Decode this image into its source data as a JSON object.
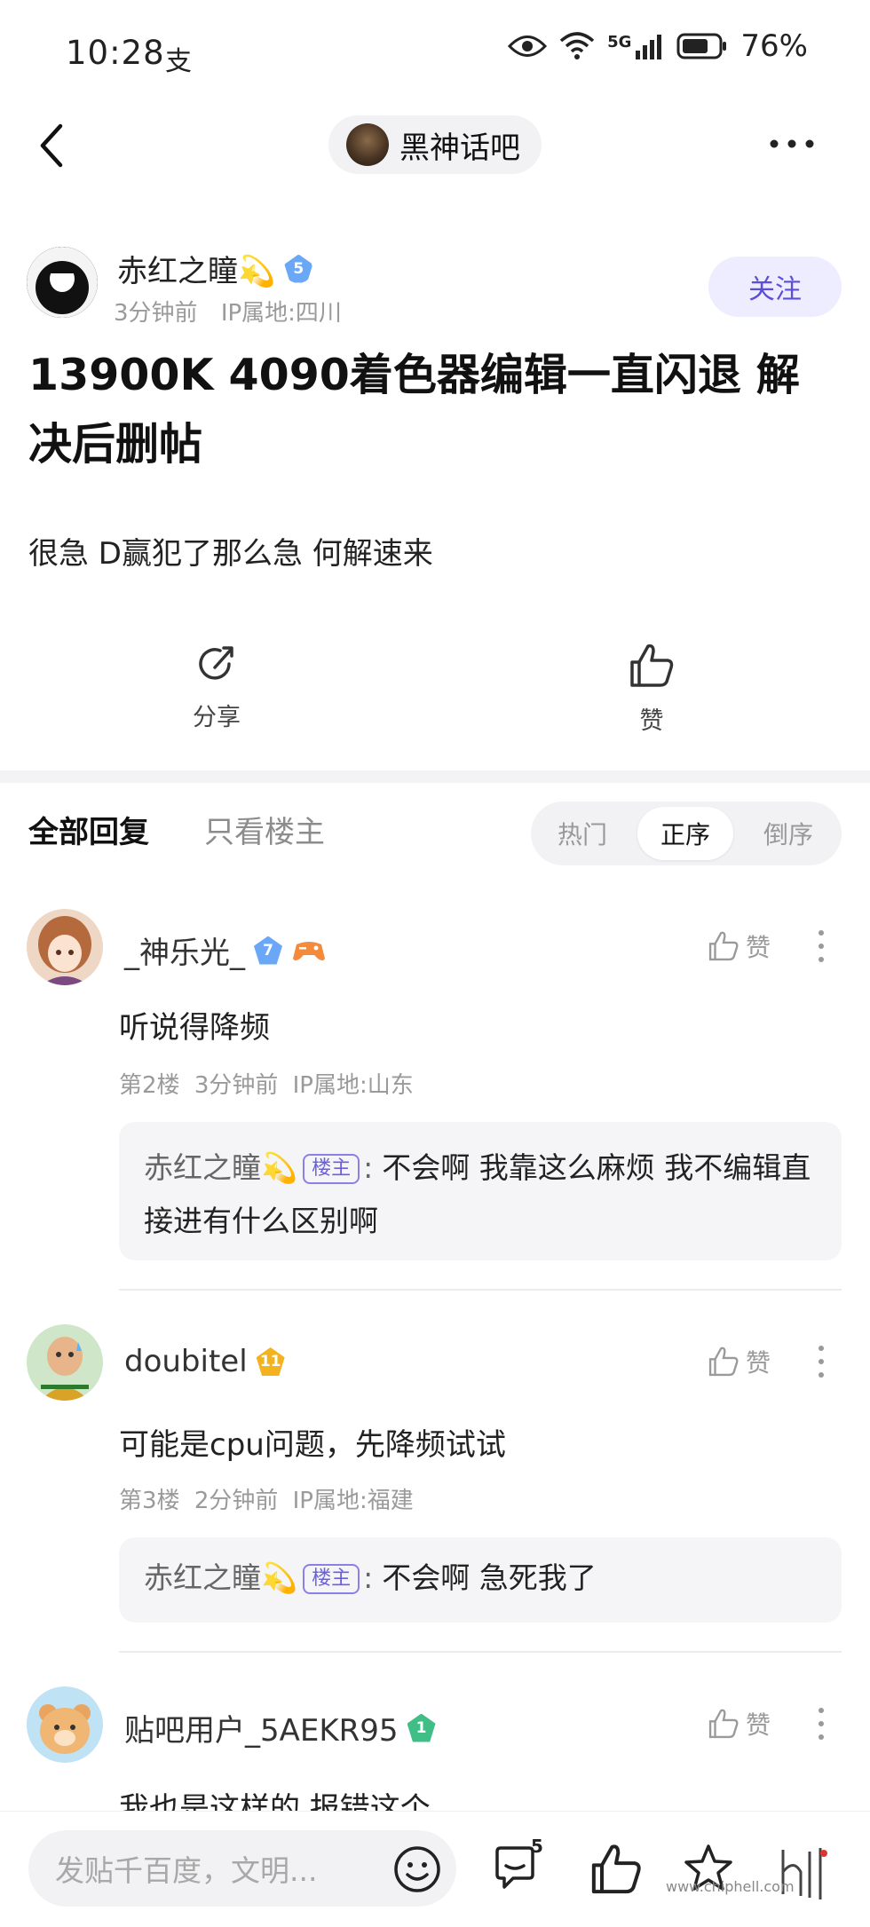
{
  "status_bar": {
    "time": "10:28",
    "alipay_glyph": "支",
    "network": "5G",
    "battery": "76%"
  },
  "header": {
    "forum_name": "黑神话吧"
  },
  "post": {
    "author": "赤红之瞳💫",
    "author_level": "5",
    "time": "3分钟前",
    "ip": "IP属地:四川",
    "follow_label": "关注",
    "title": "13900K  4090着色器编辑一直闪退 解决后删帖",
    "body": "很急 D赢犯了那么急 何解速来",
    "share_label": "分享",
    "like_label": "赞"
  },
  "tabs": {
    "all_label": "全部回复",
    "host_only_label": "只看楼主"
  },
  "sort": {
    "options": [
      "热门",
      "正序",
      "倒序"
    ],
    "selected": "正序"
  },
  "comments": [
    {
      "name": "_神乐光_",
      "level": "7",
      "text": "听说得降频",
      "floor": "第2楼",
      "time": "3分钟前",
      "ip": "IP属地:山东",
      "like_label": "赞",
      "reply": {
        "author": "赤红之瞳💫",
        "tag": "楼主",
        "text": "不会啊 我靠这么麻烦 我不编辑直接进有什么区别啊"
      }
    },
    {
      "name": "doubitel",
      "level": "11",
      "text": "可能是cpu问题，先降频试试",
      "floor": "第3楼",
      "time": "2分钟前",
      "ip": "IP属地:福建",
      "like_label": "赞",
      "reply": {
        "author": "赤红之瞳💫",
        "tag": "楼主",
        "text": "不会啊 急死我了"
      }
    },
    {
      "name": "贴吧用户_5AEKR95",
      "level": "1",
      "text": "我也是这样的 报错这个",
      "like_label": "赞"
    }
  ],
  "bottom_bar": {
    "placeholder": "发贴千百度，文明...",
    "comment_count": "5"
  },
  "watermark": "www.chiphell.com",
  "colors": {
    "accent": "#5b4fd9",
    "follow_bg": "#eeecff",
    "gray_text": "#9a9a9a",
    "reply_bg": "#f5f5f7"
  }
}
